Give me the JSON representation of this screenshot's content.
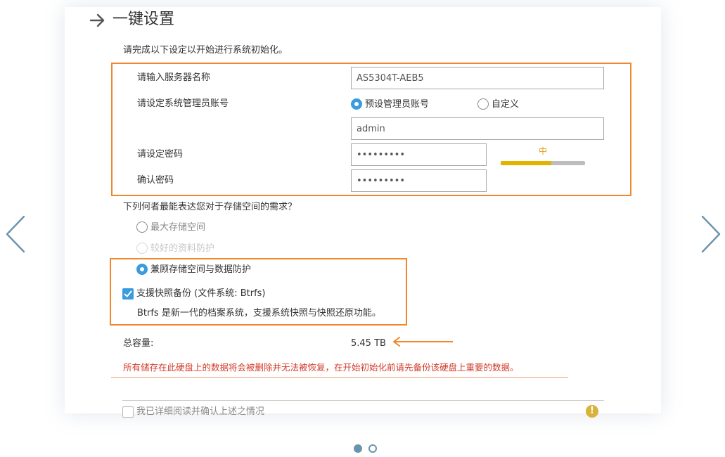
{
  "header": {
    "title": "一键设置",
    "intro": "请完成以下设定以开始进行系统初始化。"
  },
  "form": {
    "server_name": {
      "label": "请输入服务器名称",
      "value": "AS5304T-AEB5"
    },
    "admin_account": {
      "label": "请设定系统管理员账号",
      "option_default": "预设管理员账号",
      "option_custom": "自定义",
      "selected": "预设管理员账号",
      "value": "admin"
    },
    "password": {
      "label": "请设定密码",
      "value": "•••••••••",
      "strength_label": "中",
      "strength_level": 0.6,
      "strength_color": "#e2b400"
    },
    "confirm_password": {
      "label": "确认密码",
      "value": "•••••••••"
    }
  },
  "storage": {
    "question": "下列何者最能表达您对于存储空间的需求？",
    "options": [
      {
        "label": "最大存储空间",
        "state": "unselected"
      },
      {
        "label": "较好的资料防护",
        "state": "disabled"
      },
      {
        "label": "兼顾存储空间与数据防护",
        "state": "selected"
      }
    ],
    "snapshot": {
      "label": "支援快照备份 (文件系统: Btrfs)",
      "checked": true,
      "description": "Btrfs 是新一代的档案系统，支援系统快照与快照还原功能。"
    }
  },
  "capacity": {
    "label": "总容量:",
    "value": "5.45 TB"
  },
  "warning": "所有储存在此硬盘上的数据将会被删除并无法被恢复，在开始初始化前请先备份该硬盘上重要的数据。",
  "confirm": {
    "label": "我已详细阅读并确认上述之情况",
    "checked": false
  },
  "pagination": {
    "current": 1,
    "total": 2
  },
  "colors": {
    "accent": "#3b9be0",
    "highlight": "#f0872a",
    "warning": "#d23a2a",
    "info": "#d9b23a",
    "nav": "#6a93ad"
  },
  "icons": {
    "title": "arrow-right-icon",
    "prev": "chevron-left-icon",
    "next": "chevron-right-icon",
    "info": "exclamation-circle-icon",
    "annotation": "arrow-left-icon"
  }
}
